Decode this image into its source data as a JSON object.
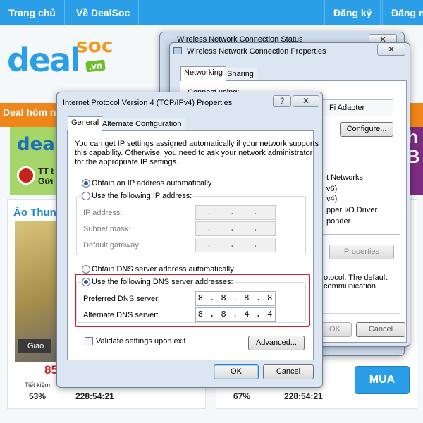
{
  "website": {
    "nav": {
      "home": "Trang chủ",
      "about": "Về DealSoc",
      "register": "Đăng ký",
      "login": "Đăng n"
    },
    "logo": {
      "deal": "deal",
      "soc": "soc",
      "vn": ".vn"
    },
    "deal_today": "Deal hôm na",
    "promo": {
      "deal": "deal",
      "line1": "TT t",
      "line2": "Gửi"
    },
    "right_banner": {
      "line1": "h",
      "line2": "B"
    },
    "product": {
      "title": "Áo Thun N",
      "sticker": "Giao",
      "price": "85.",
      "save_label": "Tiết kiệm",
      "save_pct": "53%",
      "countdown": "228:54:21"
    },
    "product2": {
      "pct": "67%",
      "countdown": "228:54:21",
      "buy_label": "MUA"
    }
  },
  "status_dialog": {
    "title": "Wireless Network Connection Status",
    "close": "✕"
  },
  "props_dialog": {
    "title": "Wireless Network Connection Properties",
    "close": "✕",
    "tabs": [
      "Networking",
      "Sharing"
    ],
    "connect_using": "Connect using:",
    "adapter": "Fi Adapter",
    "configure_label": "Configure...",
    "items": [
      "t Networks",
      "v6)",
      "v4)",
      "pper I/O Driver",
      "ponder"
    ],
    "properties_label": "Properties",
    "description": [
      "otocol. The default",
      "communication"
    ],
    "ok_label": "OK",
    "cancel_label": "Cancel"
  },
  "ipv4_dialog": {
    "title": "Internet Protocol Version 4 (TCP/IPv4) Properties",
    "help": "?",
    "close": "✕",
    "tabs": {
      "general": "General",
      "alternate": "Alternate Configuration"
    },
    "intro": [
      "You can get IP settings assigned automatically if your network supports",
      "this capability. Otherwise, you need to ask your network administrator",
      "for the appropriate IP settings."
    ],
    "ip_auto_label": "Obtain an IP address automatically",
    "ip_manual_label": "Use the following IP address:",
    "ip_address_label": "IP address:",
    "subnet_label": "Subnet mask:",
    "gateway_label": "Default gateway:",
    "empty_ip": " .   .   .  ",
    "dns_auto_label": "Obtain DNS server address automatically",
    "dns_manual_label": "Use the following DNS server addresses:",
    "preferred_dns_label": "Preferred DNS server:",
    "preferred_dns_value": "8 . 8 . 8 . 8",
    "alternate_dns_label": "Alternate DNS server:",
    "alternate_dns_value": "8 . 8 . 4 . 4",
    "validate_label": "Validate settings upon exit",
    "advanced_label": "Advanced...",
    "ok_label": "OK",
    "cancel_label": "Cancel",
    "ip_auto_selected": true,
    "dns_manual_selected": true,
    "validate_checked": false
  },
  "colors": {
    "highlight": "#d1222b",
    "site_blue": "#2a9ee6",
    "site_orange": "#f0861a"
  }
}
